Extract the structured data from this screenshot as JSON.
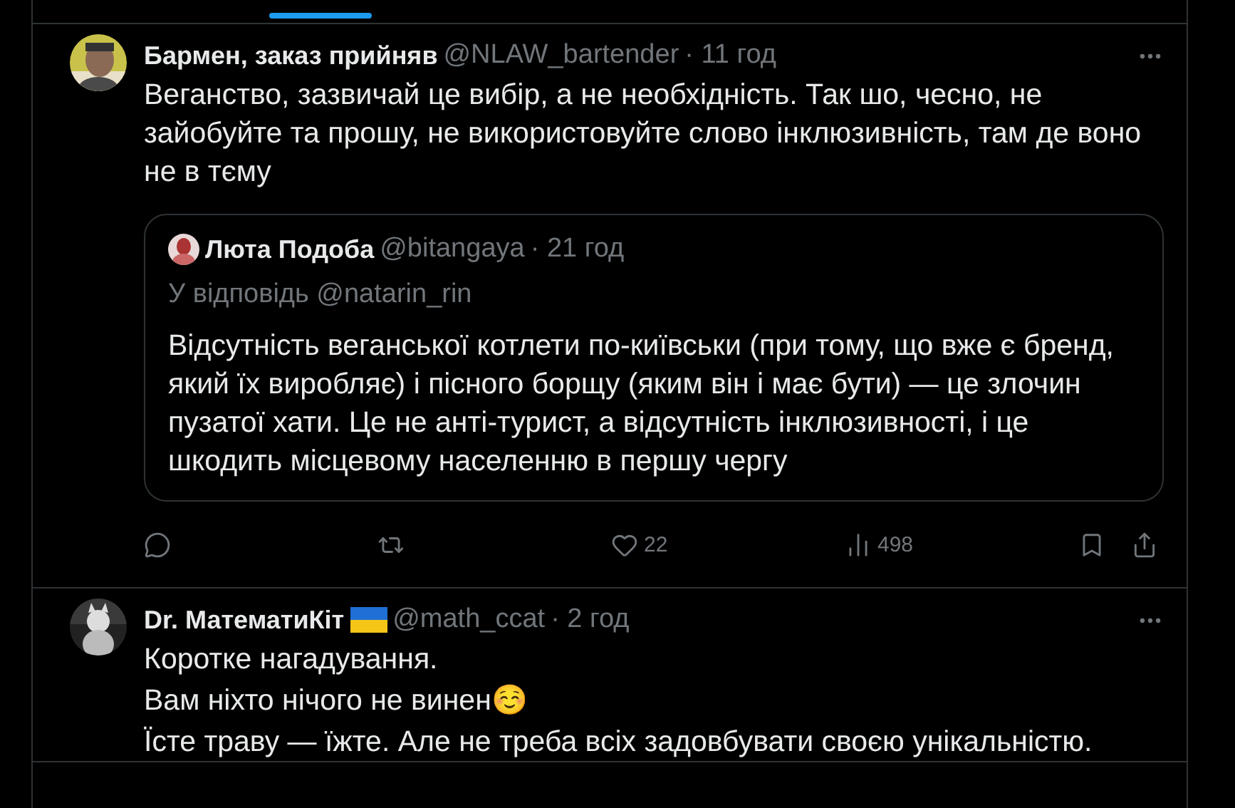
{
  "tab_indicator": {
    "selected": true
  },
  "tweets": [
    {
      "name": "Бармен, заказ прийняв",
      "handle": "@NLAW_bartender",
      "time": "· 11 год",
      "flag": false,
      "lines": [
        "Веганство, зазвичай це вибір, а не необхідність. Так шо, чесно, не зайобуйте та прошу, не використовуйте слово інклюзивність, там де воно не в тєму"
      ],
      "quote": {
        "name": "Люта Подоба",
        "handle": "@bitangaya",
        "time": "· 21 год",
        "reply_to": "У відповідь @natarin_rin",
        "text": "Відсутність веганської котлети по-київськи (при тому, що вже є бренд, який їх виробляє) і пісного борщу (яким він і має бути) — це злочин пузатої хати. Це не анті-турист, а відсутність інклюзивності, і це шкодить місцевому населенню в першу чергу"
      },
      "actions": [
        {
          "kind": "reply"
        },
        {
          "kind": "repost"
        },
        {
          "kind": "like",
          "count": "22"
        },
        {
          "kind": "views",
          "count": "498"
        },
        {
          "kind": "bookmark"
        },
        {
          "kind": "share"
        }
      ]
    },
    {
      "name": "Dr. МатематиКіт",
      "handle": "@math_ccat",
      "time": "· 2 год",
      "flag": true,
      "lines": [
        "Коротке нагадування.",
        "Вам ніхто нічого не винен☺️",
        "Їсте траву — їжте. Але не треба всіх задовбувати своєю унікальністю."
      ]
    }
  ]
}
